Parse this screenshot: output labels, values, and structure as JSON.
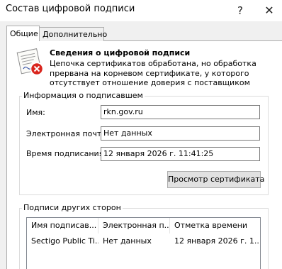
{
  "window": {
    "title": "Состав цифровой подписи",
    "help_label": "?",
    "close_label": "✕"
  },
  "tabs": [
    {
      "label": "Общие",
      "active": true
    },
    {
      "label": "Дополнительно",
      "active": false
    }
  ],
  "header": {
    "icon": "certificate-error-icon",
    "title": "Сведения о цифровой подписи",
    "description": "Цепочка сертификатов обработана, но обработка прервана на корневом сертификате, у которого отсутствует отношение доверия с поставщиком доверия."
  },
  "signer_info": {
    "group_label": "Информация о подписавшем",
    "name_label": "Имя:",
    "name_value": "rkn.gov.ru",
    "email_label": "Электронная почта:",
    "email_value": "Нет данных",
    "time_label": "Время подписания:",
    "time_value": "12 января 2026 г. 11:41:25",
    "view_cert_button": "Просмотр сертификата"
  },
  "countersignatures": {
    "group_label": "Подписи других сторон",
    "columns": [
      "Имя подписав...",
      "Электронная п...",
      "Отметка времени"
    ],
    "rows": [
      [
        "Sectigo Public Ti...",
        "Нет данных",
        "12 января 2026 г. 1..."
      ]
    ]
  },
  "colors": {
    "accent_error": "#d9251d",
    "panel_bg": "#ffffff",
    "dialog_bg": "#f0f0f0",
    "button_bg": "#e1e1e1"
  }
}
